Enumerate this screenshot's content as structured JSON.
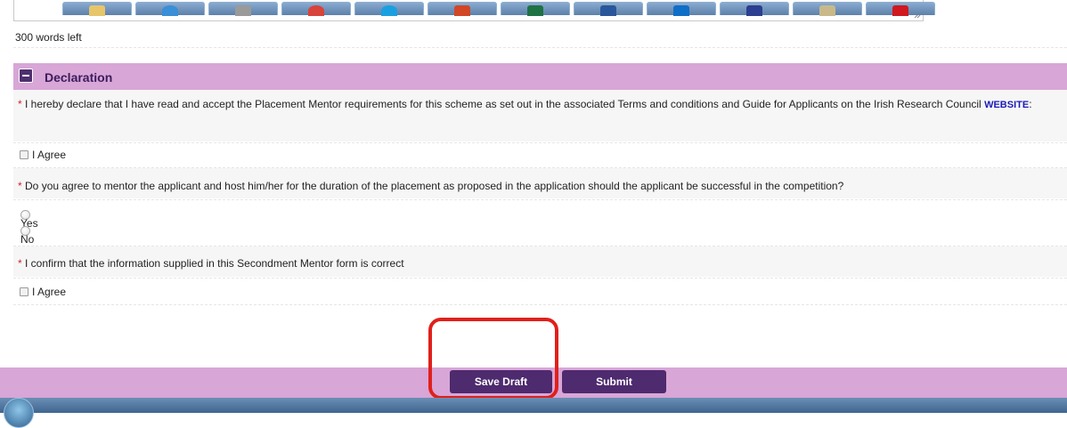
{
  "comments": {
    "words_left": "300 words left"
  },
  "declaration": {
    "title": "Declaration",
    "q1_text": "I hereby declare that I have read and accept the Placement Mentor requirements for this scheme as set out in the associated Terms and conditions and Guide for Applicants on the Irish Research Council",
    "q1_link": "WEBSITE",
    "q1_suffix": ":",
    "q1_checkbox": "I Agree",
    "q2_text": "Do you agree to mentor the applicant and host him/her for the duration of the placement as proposed in the application should the applicant be successful in the competition?",
    "q2_options": [
      "Yes",
      "No"
    ],
    "q3_text": "I confirm that the information supplied in this Secondment Mentor form is correct",
    "q3_checkbox": "I Agree",
    "required_marker": "*"
  },
  "footer": {
    "save_draft": "Save Draft",
    "submit": "Submit"
  },
  "taskbar": {
    "items": [
      "start-orb",
      "file-explorer-icon",
      "internet-explorer-icon",
      "app-icon",
      "chrome-icon",
      "skype-icon",
      "powerpoint-icon",
      "excel-icon",
      "word-icon",
      "outlook-icon",
      "app-icon",
      "app-icon",
      "acrobat-icon"
    ]
  },
  "colors": {
    "header_bg": "#d8a6d7",
    "button_bg": "#4e2a6e",
    "highlight": "#e0201b"
  }
}
